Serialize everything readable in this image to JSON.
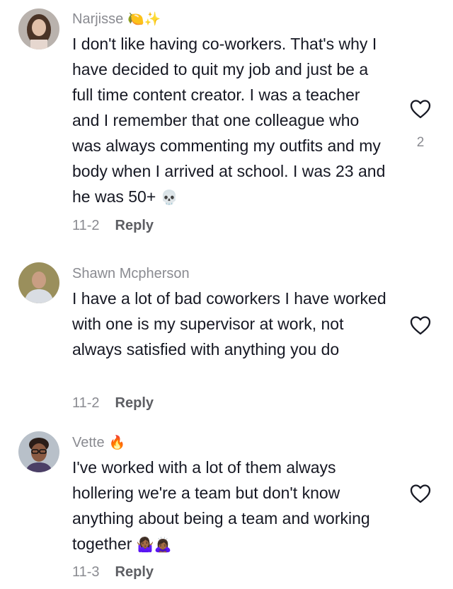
{
  "comments": [
    {
      "author": "Narjisse",
      "author_emojis": "🍋✨",
      "text": "I don't like having co-workers. That's why I have decided to quit my job and just be a full time content creator. I was a teacher and I remember that one colleague who was always commenting my outfits and my body when I arrived at school. I was 23 and he was 50+",
      "text_emoji": "💀",
      "date": "11-2",
      "reply_label": "Reply",
      "like_count": "2"
    },
    {
      "author": "Shawn Mcpherson",
      "text": "I have a lot of bad coworkers I have worked with one is my supervisor at work, not always satisfied with anything you do",
      "date": "11-2",
      "reply_label": "Reply"
    },
    {
      "author": "Vette",
      "author_emojis": "🔥",
      "text": "I've worked with a lot of them always hollering we're a team but don't know anything about being a team and working together",
      "text_emoji": "🤷🏾‍♀️🙇🏾‍♀️",
      "date": "11-3",
      "reply_label": "Reply"
    }
  ],
  "icons": {
    "like": "heart-outline-icon"
  },
  "colors": {
    "primary_text": "#161823",
    "secondary_text": "#8a8b91"
  }
}
